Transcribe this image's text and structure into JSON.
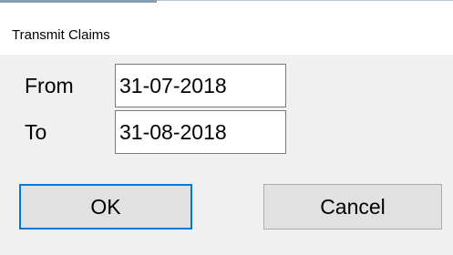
{
  "window": {
    "title": "Transmit Claims"
  },
  "form": {
    "from_label": "From",
    "from_value": "31-07-2018",
    "to_label": "To",
    "to_value": "31-08-2018"
  },
  "buttons": {
    "ok_label": "OK",
    "cancel_label": "Cancel"
  },
  "colors": {
    "dialog_background": "#f0f0f0",
    "titlebar_background": "#ffffff",
    "default_button_border": "#0078d7",
    "button_background": "#e1e1e1"
  }
}
